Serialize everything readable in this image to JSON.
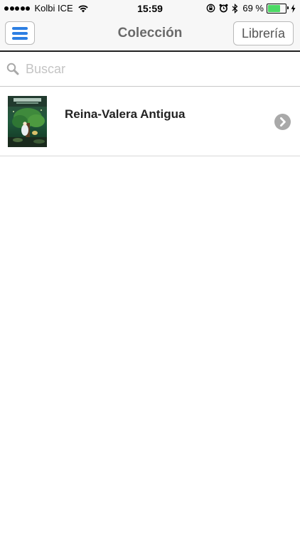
{
  "status_bar": {
    "carrier": "Kolbi ICE",
    "time": "15:59",
    "battery_percent": "69 %",
    "battery_level": 0.69,
    "icons": [
      "signal-dots-icon",
      "wifi-icon",
      "orientation-lock-icon",
      "alarm-icon",
      "bluetooth-icon",
      "battery-icon",
      "charging-bolt-icon"
    ],
    "battery_color": "#4cd964"
  },
  "nav": {
    "title": "Colección",
    "library_label": "Librería",
    "menu_icon": "hamburger-menu-icon",
    "accent_color": "#2d7fe3"
  },
  "search": {
    "placeholder": "Buscar",
    "value": "",
    "icon": "search-icon"
  },
  "collection": {
    "items": [
      {
        "title": "Reina-Valera Antigua",
        "cover_icon": "book-cover-image",
        "action_icon": "chevron-right-circle-icon"
      }
    ]
  }
}
